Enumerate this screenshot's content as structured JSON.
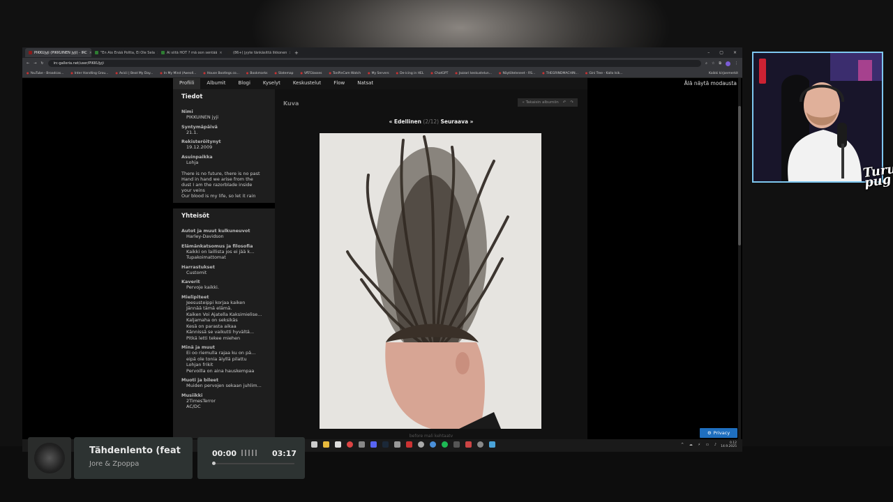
{
  "browser": {
    "tabs": [
      {
        "label": "PIKKUjyji (PIKKUINEN jyji) - IRC"
      },
      {
        "label": "\"En Aio Enää Poltta, Ei Ole Sela"
      },
      {
        "label": "Ai siitä HOT ? mä oon sentää"
      },
      {
        "label": "(86+) jyyte tänkäsittä likkonen"
      }
    ],
    "url": "irc-galleria.net/user/PIKKUjyji",
    "bookmarks": [
      "YouTube - Broadcas...",
      "Inter Handling Grou...",
      "Avicii | Beat My Day...",
      "In My Mind (Aweoll...",
      "House Bootlegs.co...",
      "Bookmarks",
      "Slatemap",
      "VÄTGlasses",
      "TonPinCam Watch",
      "My Servers",
      "De-icing in HEL",
      "ChatGPT",
      "Jazzari keskustelun...",
      "Näytöteleneet - RS...",
      "THEGRINDMACHIN...",
      "Gini Tree - Kallo Isik..."
    ],
    "bookmarks_right": "Kaikki kirjanmerkit"
  },
  "site": {
    "nav": [
      "Profiili",
      "Albumit",
      "Blogi",
      "Kyselyt",
      "Keskustelut",
      "Flow",
      "Natsat"
    ],
    "dont_show": "Älä näytä modausta",
    "tiedot": {
      "title": "Tiedot",
      "fields": [
        {
          "label": "Nimi",
          "value": "PIKKUINEN jyji"
        },
        {
          "label": "Syntymäpäivä",
          "value": "21.1."
        },
        {
          "label": "Rekisteröitynyt",
          "value": "19.12.2009"
        },
        {
          "label": "Asuinpaikka",
          "value": "Lohja"
        }
      ],
      "bio": [
        "There is no future, there is no past",
        "Hand in hand we arise from the",
        "dust I am the razorblade inside",
        "your veins",
        "Our blood is my life, so let it rain"
      ]
    },
    "yhteisot": {
      "title": "Yhteisöt",
      "groups": [
        {
          "label": "Autot ja muut kulkuneuvot",
          "items": [
            "Harley-Davidson"
          ]
        },
        {
          "label": "Elämänkatsomus ja filosofia",
          "items": [
            "Kaikki on laillista jos ei jää k...",
            "Tupakoimattomat"
          ]
        },
        {
          "label": "Harrastukset",
          "items": [
            "Customit"
          ]
        },
        {
          "label": "Kaverit",
          "items": [
            "Pervoje kaikki."
          ]
        },
        {
          "label": "Mielipiteet",
          "items": [
            "Jeesusteippi korjaa kaiken",
            "Jännää tämä elämä.",
            "Kaiken Voi Ajatella Kaksimielise...",
            "Kaljamaha on seksikäs",
            "Kesä on parasta aikaa",
            "Kännissä se vaikutti hyvältä...",
            "Pitkä letti tekee miehen"
          ]
        },
        {
          "label": "Minä ja muut",
          "items": [
            "Ei oo riemulla rajaa ku on pä...",
            "eipä ole tonia äiyllä pilattu",
            "Lohjan frikit",
            "Pervoilla on aina hauskempaa"
          ]
        },
        {
          "label": "Muoti ja bileet",
          "items": [
            "Muiden pervojen sekaan juhlim..."
          ]
        },
        {
          "label": "Musiikki",
          "items": [
            "2TimesTerror",
            "AC/DC"
          ]
        }
      ]
    },
    "photo": {
      "heading": "Kuva",
      "back_label": "« Takaisin albumiin",
      "prev": "« Edellinen",
      "counter": "(2/12)",
      "next": "Seuraava »",
      "caption": "before mali kehtaatv"
    }
  },
  "privacy_label": "Privacy",
  "taskbar": {
    "time": "0.12",
    "date": "14.9.2025"
  },
  "music": {
    "title": "Tähdenlento (feat",
    "artist": "Jore & Zpoppa",
    "elapsed": "00:00",
    "duration": "03:17",
    "progress": 0.0
  },
  "stream_logo": "Turun pug",
  "colors": {
    "accent": "#1f6fbf",
    "cam_border": "#7ec8f0"
  }
}
